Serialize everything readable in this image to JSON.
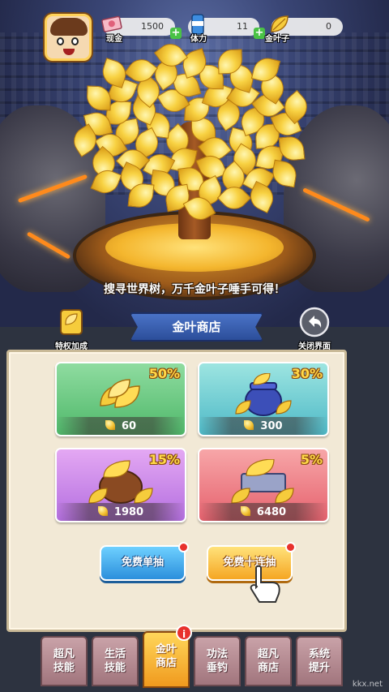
{
  "resources": [
    {
      "label": "现金",
      "value": "1500",
      "icon": "ticket-icon"
    },
    {
      "label": "体力",
      "value": "11",
      "icon": "energy-can-icon"
    },
    {
      "label": "金叶子",
      "value": "0",
      "icon": "gold-leaf-icon"
    }
  ],
  "slogan": "搜寻世界树，万千金叶子唾手可得！",
  "privilege_label": "特权加成",
  "shop_title": "金叶商店",
  "close_label": "关闭界面",
  "cards": [
    {
      "percent": "50%",
      "price": "60",
      "color": "#4fb86a"
    },
    {
      "percent": "30%",
      "price": "300",
      "color": "#4eb9c7"
    },
    {
      "percent": "15%",
      "price": "1980",
      "color": "#b46fe0"
    },
    {
      "percent": "5%",
      "price": "6480",
      "color": "#e6626e"
    }
  ],
  "buttons": {
    "single": "免费单抽",
    "ten": "免费十连抽"
  },
  "tabs": [
    {
      "line1": "超凡",
      "line2": "技能"
    },
    {
      "line1": "生活",
      "line2": "技能"
    },
    {
      "line1": "金叶",
      "line2": "商店"
    },
    {
      "line1": "功法",
      "line2": "垂钓"
    },
    {
      "line1": "超凡",
      "line2": "商店"
    },
    {
      "line1": "系统",
      "line2": "提升"
    }
  ],
  "tab_badge": "i",
  "watermark": "kkx.net"
}
